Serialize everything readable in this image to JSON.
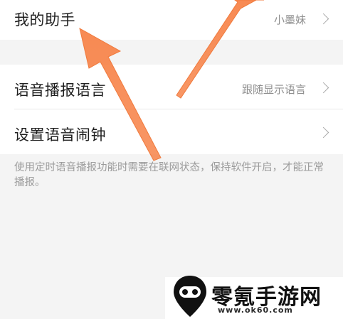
{
  "settings": {
    "assistant": {
      "label": "我的助手",
      "value": "小墨妹"
    },
    "voice_language": {
      "label": "语音播报语言",
      "value": "跟随显示语言"
    },
    "voice_alarm": {
      "label": "设置语音闹钟"
    },
    "note": "使用定时语音播报功能时需要在联网状态，保持软件开启，才能正常播报。"
  },
  "watermark": {
    "title": "零氪手游网",
    "url": "www.ok60.com"
  },
  "icons": {
    "row_chevron": "chevron-right-icon",
    "annotation": "arrow-annotation-icon",
    "watermark": "game-controller-pin-icon"
  },
  "colors": {
    "annotation_arrow": "#f7844a",
    "background": "#f4f4f4",
    "row_background": "#ffffff",
    "secondary_text": "#8e8e8e"
  }
}
